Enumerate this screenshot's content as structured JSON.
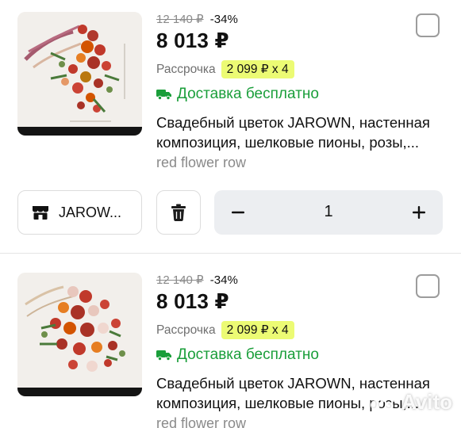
{
  "products": [
    {
      "image_alt": "red flower wall composition",
      "old_price": "12 140 ₽",
      "discount": "-34%",
      "price": "8 013 ₽",
      "installment_label": "Рассрочка",
      "installment_value": "2 099 ₽ х 4",
      "delivery_label": "Доставка бесплатно",
      "title": "Свадебный цветок JAROWN, настенная композиция, шелковые пионы, розы,...",
      "variant": "red flower row",
      "selected": false
    },
    {
      "image_alt": "red flower wall composition",
      "old_price": "12 140 ₽",
      "discount": "-34%",
      "price": "8 013 ₽",
      "installment_label": "Рассрочка",
      "installment_value": "2 099 ₽ х 4",
      "delivery_label": "Доставка бесплатно",
      "title": "Свадебный цветок JAROWN, настенная композиция, шелковые пионы, розы,...",
      "variant": "red flower row",
      "selected": false
    }
  ],
  "seller": {
    "label": "JAROW..."
  },
  "stepper": {
    "minus": "−",
    "value": "1",
    "plus": "+"
  },
  "watermark": {
    "text": "Avito"
  },
  "colors": {
    "accent_green": "#1a9e3a",
    "installment_badge": "#ecfb74",
    "stepper_bg": "#eceef1"
  },
  "icons": [
    "truck-icon",
    "store-icon",
    "trash-icon",
    "checkbox"
  ]
}
